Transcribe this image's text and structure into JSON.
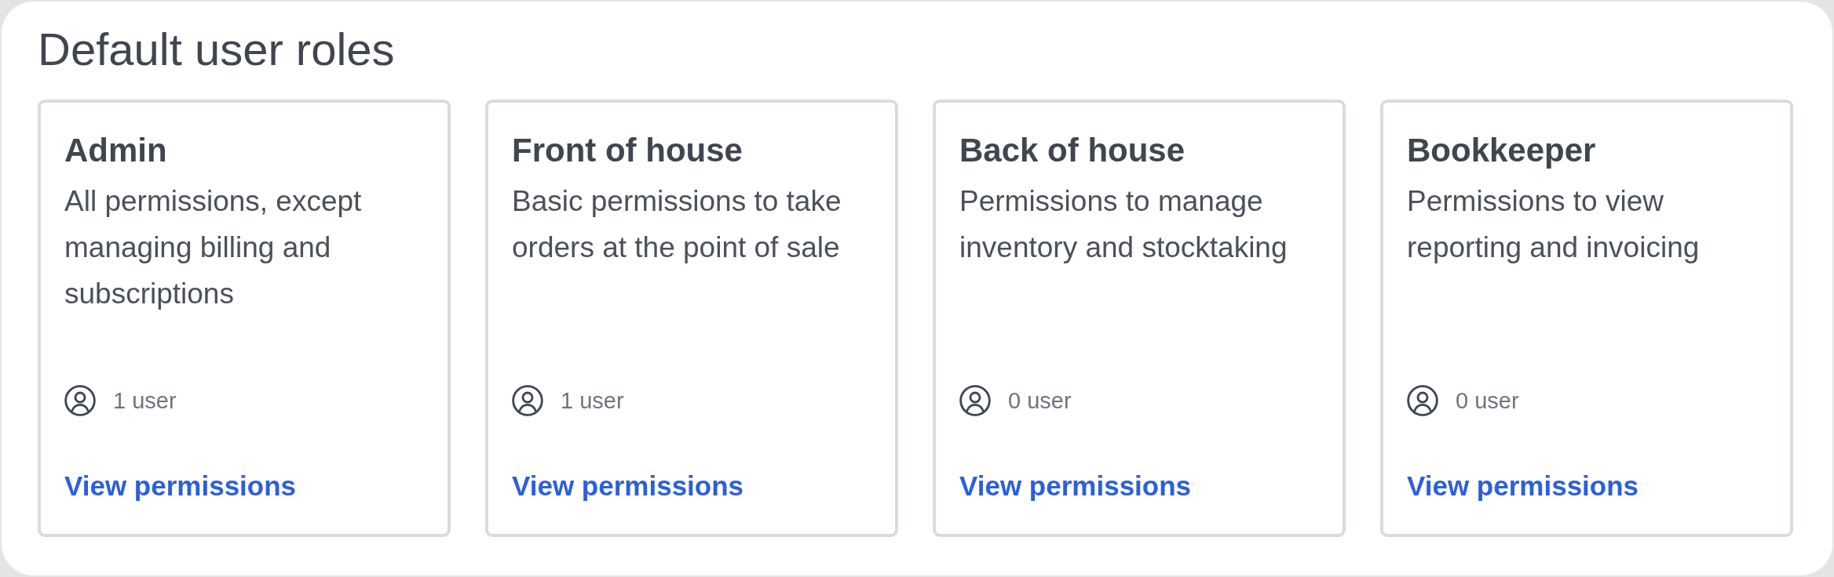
{
  "title": "Default user roles",
  "roles": [
    {
      "name": "Admin",
      "description": "All permissions, except managing billing and subscriptions",
      "users": "1 user",
      "link": "View permissions"
    },
    {
      "name": "Front of house",
      "description": "Basic permissions to take orders at the point of sale",
      "users": "1 user",
      "link": "View permissions"
    },
    {
      "name": "Back of house",
      "description": "Permissions to manage inventory and stocktaking",
      "users": "0 user",
      "link": "View permissions"
    },
    {
      "name": "Bookkeeper",
      "description": "Permissions to view reporting and invoicing",
      "users": "0 user",
      "link": "View permissions"
    }
  ]
}
